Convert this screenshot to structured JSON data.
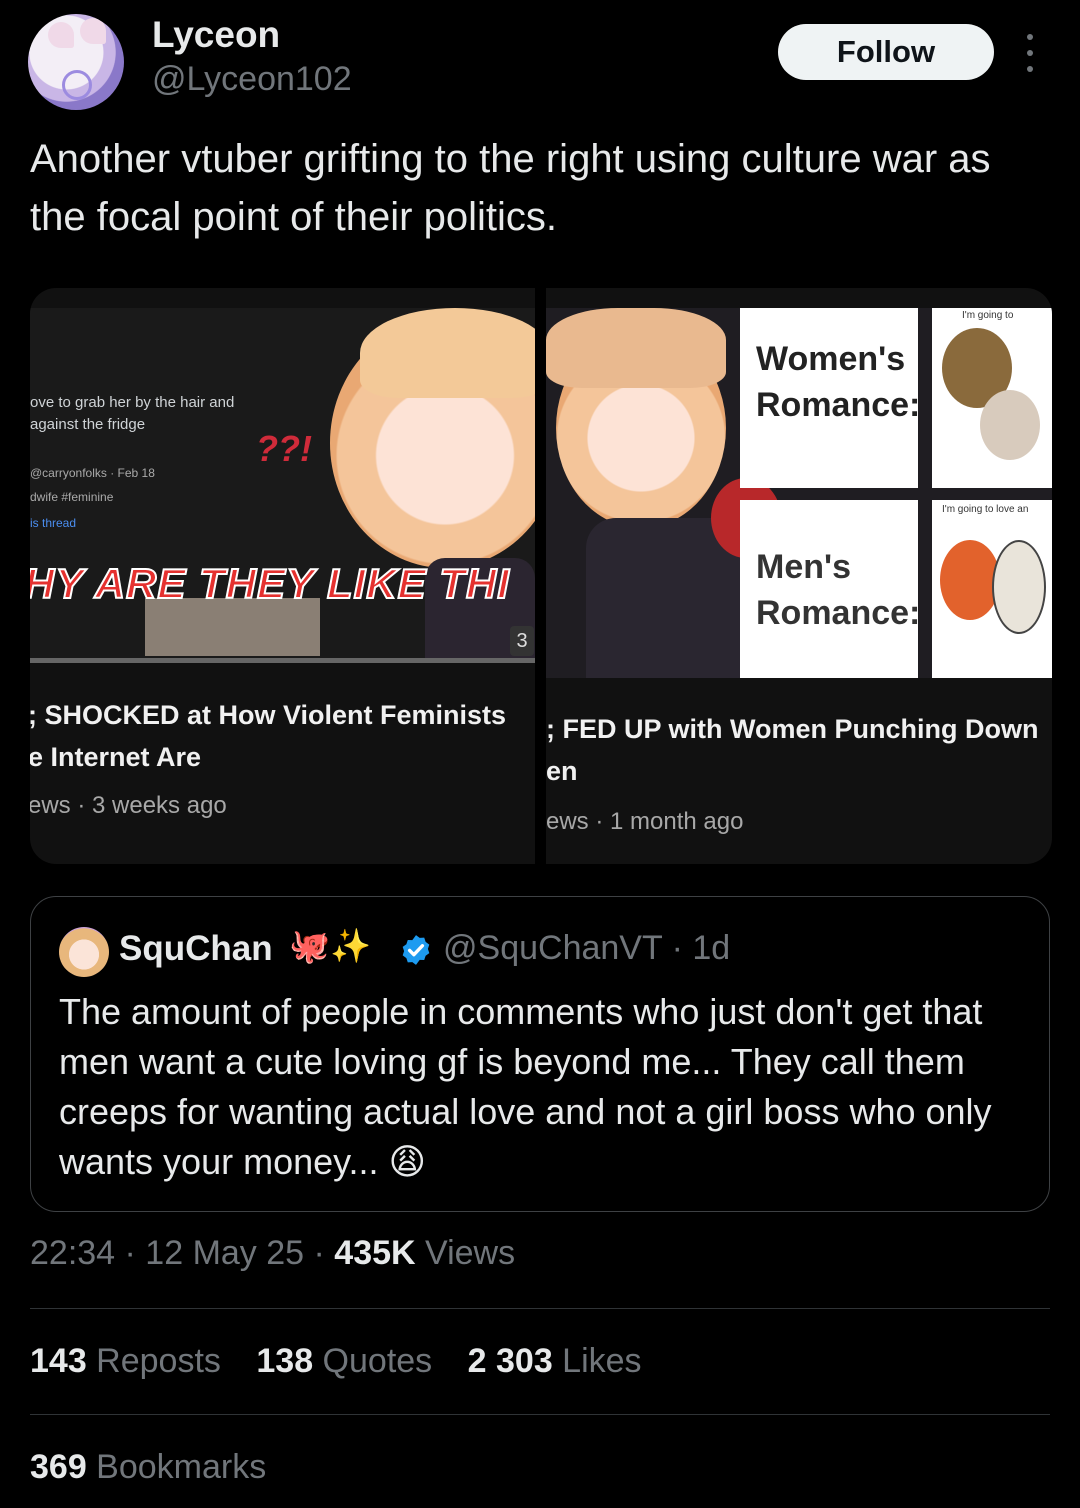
{
  "author": {
    "name": "Lyceon",
    "handle": "@Lyceon102",
    "follow_label": "Follow"
  },
  "tweet": {
    "text": "Another vtuber grifting to the right using culture war as the focal point of their politics."
  },
  "media": {
    "left_video": {
      "snippet_line1": "ove to grab her by the hair and",
      "snippet_line2": "against the fridge",
      "snippet_meta": "@carryonfolks · Feb 18",
      "snippet_tag": "dwife #feminine",
      "snippet_link": "is thread",
      "question_marks": "??!",
      "thumb_title": "HY ARE THEY LIKE THI",
      "duration_badge": "3",
      "title_line1": "; SHOCKED at How Violent Feminists",
      "title_line2": "e Internet Are",
      "meta": "ews · 3 weeks ago"
    },
    "right_video": {
      "womens": "Women's Romance:",
      "mens": "Men's Romance:",
      "tiny_top": "I'm going to",
      "tiny_bottom": "I'm going to love an",
      "title_line1": "; FED UP with Women Punching Down",
      "title_line2": "en",
      "meta": "ews · 1 month ago"
    }
  },
  "quote": {
    "name": "SquChan",
    "emoji": "🐙✨",
    "handle_time": "@SquChanVT · 1d",
    "text": "The amount of people in comments who just don't get that men want a cute loving gf is beyond me... They call them creeps for wanting actual love and not a girl boss who only wants your money... 😩",
    "verified_color": "#1d9bf0"
  },
  "meta": {
    "time": "22:34 · 12 May 25 · ",
    "views_count": "435K",
    "views_label": " Views"
  },
  "stats": {
    "reposts_count": "143",
    "reposts_label": " Reposts",
    "quotes_count": "138",
    "quotes_label": " Quotes",
    "likes_count": "2 303",
    "likes_label": " Likes",
    "bookmarks_count": "369",
    "bookmarks_label": " Bookmarks"
  }
}
